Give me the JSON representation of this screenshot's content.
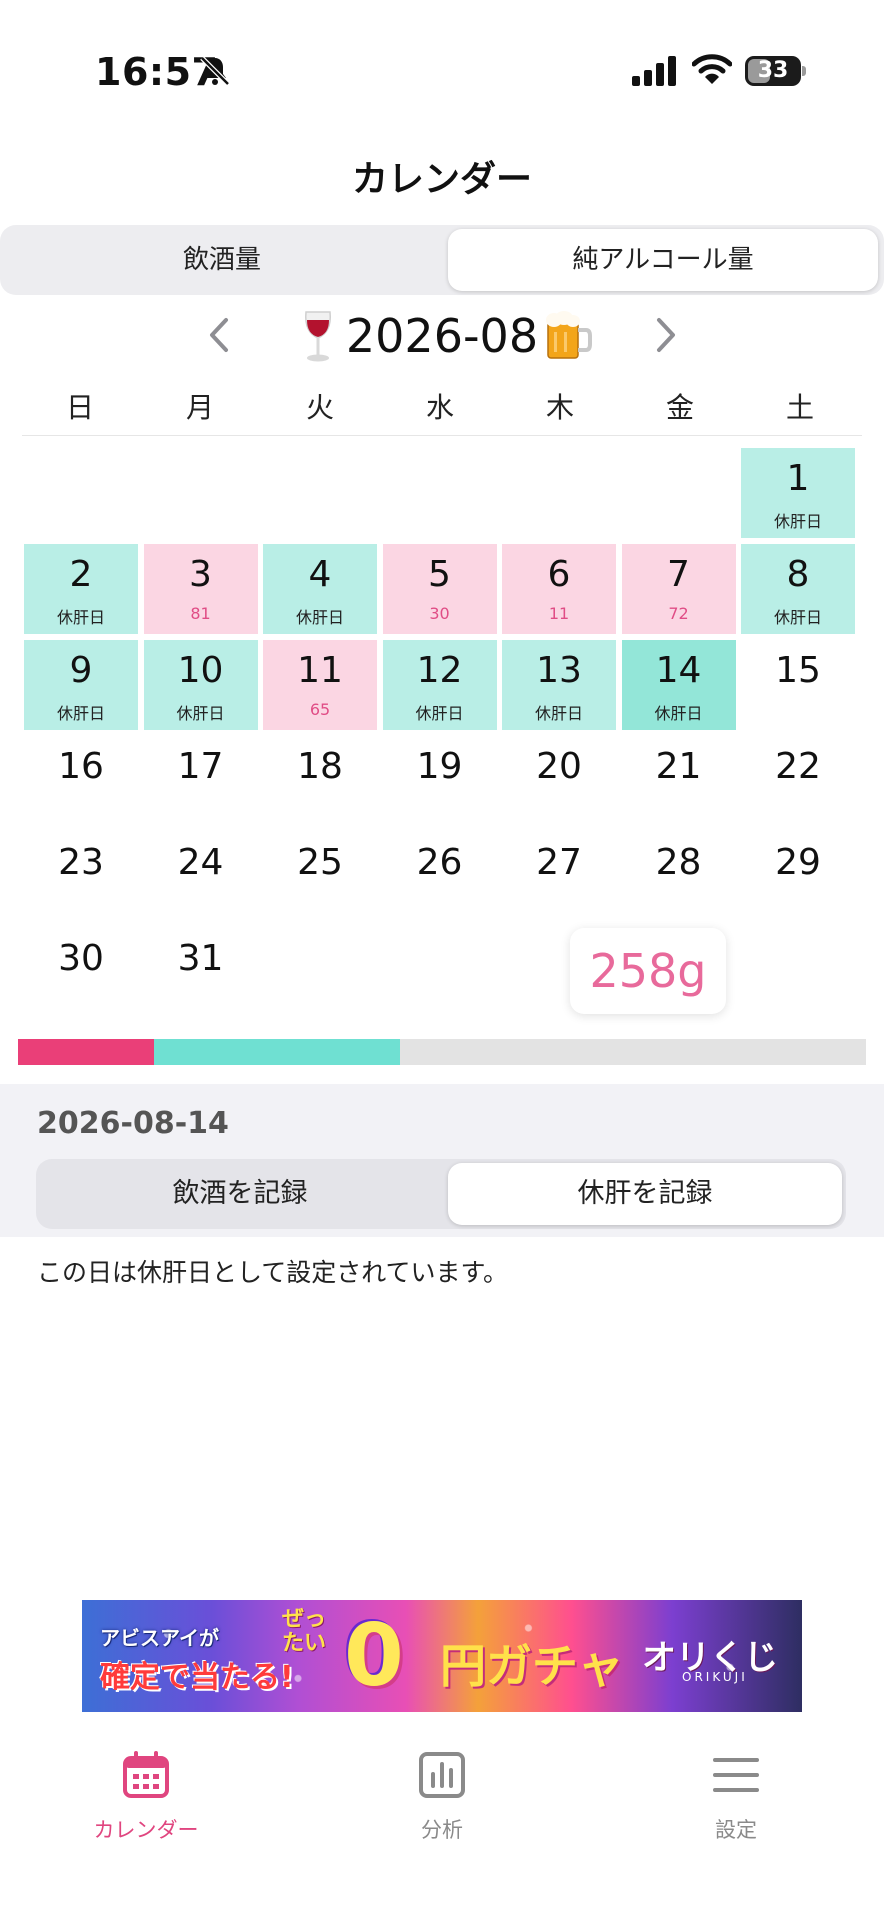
{
  "status_bar": {
    "time": "16:57",
    "battery": "33"
  },
  "header": {
    "title": "カレンダー"
  },
  "mode_tabs": {
    "left": "飲酒量",
    "right": "純アルコール量",
    "selected": "純アルコール量"
  },
  "month_nav": {
    "label": "2026-08",
    "left_icon": "wine-glass-icon",
    "right_icon": "beer-mug-icon"
  },
  "weekdays": [
    "日",
    "月",
    "火",
    "水",
    "木",
    "金",
    "土"
  ],
  "days": [
    {
      "day": "1",
      "status": "rest",
      "sub": "休肝日"
    },
    {
      "day": "2",
      "status": "rest",
      "sub": "休肝日"
    },
    {
      "day": "3",
      "status": "drink",
      "sub": "81"
    },
    {
      "day": "4",
      "status": "rest",
      "sub": "休肝日"
    },
    {
      "day": "5",
      "status": "drink",
      "sub": "30"
    },
    {
      "day": "6",
      "status": "drink",
      "sub": "11"
    },
    {
      "day": "7",
      "status": "drink",
      "sub": "72"
    },
    {
      "day": "8",
      "status": "rest",
      "sub": "休肝日"
    },
    {
      "day": "9",
      "status": "rest",
      "sub": "休肝日"
    },
    {
      "day": "10",
      "status": "rest",
      "sub": "休肝日"
    },
    {
      "day": "11",
      "status": "drink",
      "sub": "65"
    },
    {
      "day": "12",
      "status": "rest",
      "sub": "休肝日"
    },
    {
      "day": "13",
      "status": "rest",
      "sub": "休肝日"
    },
    {
      "day": "14",
      "status": "rest",
      "sub": "休肝日",
      "selected": true
    },
    {
      "day": "15",
      "status": "none",
      "sub": ""
    },
    {
      "day": "16",
      "status": "none",
      "sub": ""
    },
    {
      "day": "17",
      "status": "none",
      "sub": ""
    },
    {
      "day": "18",
      "status": "none",
      "sub": ""
    },
    {
      "day": "19",
      "status": "none",
      "sub": ""
    },
    {
      "day": "20",
      "status": "none",
      "sub": ""
    },
    {
      "day": "21",
      "status": "none",
      "sub": ""
    },
    {
      "day": "22",
      "status": "none",
      "sub": ""
    },
    {
      "day": "23",
      "status": "none",
      "sub": ""
    },
    {
      "day": "24",
      "status": "none",
      "sub": ""
    },
    {
      "day": "25",
      "status": "none",
      "sub": ""
    },
    {
      "day": "26",
      "status": "none",
      "sub": ""
    },
    {
      "day": "27",
      "status": "none",
      "sub": ""
    },
    {
      "day": "28",
      "status": "none",
      "sub": ""
    },
    {
      "day": "29",
      "status": "none",
      "sub": ""
    },
    {
      "day": "30",
      "status": "none",
      "sub": ""
    },
    {
      "day": "31",
      "status": "none",
      "sub": ""
    }
  ],
  "total": "258g",
  "progress": {
    "drink_fraction": 0.16,
    "rest_fraction": 0.29,
    "drink_color": "#ea3f78",
    "rest_color": "#6fe0d2"
  },
  "detail": {
    "date": "2026-08-14",
    "record_drink": "飲酒を記録",
    "record_rest": "休肝を記録",
    "selected": "休肝を記録",
    "message": "この日は休肝日として設定されています。"
  },
  "ad": {
    "line1": "アビスアイが",
    "line2": "確定で当たる!",
    "line3": "ぜったい",
    "line4": "0",
    "line5": "円ガチャ",
    "line6": "オリくじ",
    "line7": "ORIKUJI"
  },
  "tab_bar": {
    "items": [
      {
        "label": "カレンダー",
        "icon": "calendar-icon",
        "active": true
      },
      {
        "label": "分析",
        "icon": "chart-icon",
        "active": false
      },
      {
        "label": "設定",
        "icon": "menu-icon",
        "active": false
      }
    ]
  },
  "colors": {
    "accent_pink": "#e0457f",
    "rest_bg": "#b9eee6",
    "drink_bg": "#fbd6e3"
  }
}
